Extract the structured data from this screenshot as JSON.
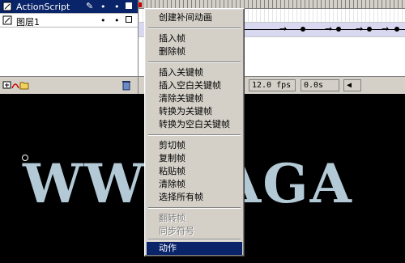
{
  "layers": [
    {
      "name": "ActionScript",
      "selected": true
    },
    {
      "name": "图层1",
      "selected": false
    }
  ],
  "status": {
    "frame_rate": "12.0 fps",
    "time": "0.0s"
  },
  "context_menu": {
    "items": [
      {
        "label": "创建补间动画",
        "enabled": true
      },
      {
        "label": "插入帧",
        "enabled": true
      },
      {
        "label": "删除帧",
        "enabled": true
      },
      {
        "label": "插入关键帧",
        "enabled": true
      },
      {
        "label": "插入空白关键帧",
        "enabled": true
      },
      {
        "label": "清除关键帧",
        "enabled": true
      },
      {
        "label": "转换为关键帧",
        "enabled": true
      },
      {
        "label": "转换为空白关键帧",
        "enabled": true
      },
      {
        "label": "剪切帧",
        "enabled": true
      },
      {
        "label": "复制帧",
        "enabled": true
      },
      {
        "label": "粘贴帧",
        "enabled": true
      },
      {
        "label": "清除帧",
        "enabled": true
      },
      {
        "label": "选择所有帧",
        "enabled": true
      },
      {
        "label": "翻转帧",
        "enabled": false
      },
      {
        "label": "同步符号",
        "enabled": false
      },
      {
        "label": "动作",
        "enabled": true,
        "highlighted": true
      }
    ]
  },
  "stage": {
    "text": "WWW.AGA"
  },
  "colors": {
    "selection": "#0a246a",
    "menu_bg": "#d4d0c8",
    "stage_bg": "#000000",
    "stage_text": "#b3cad6"
  }
}
